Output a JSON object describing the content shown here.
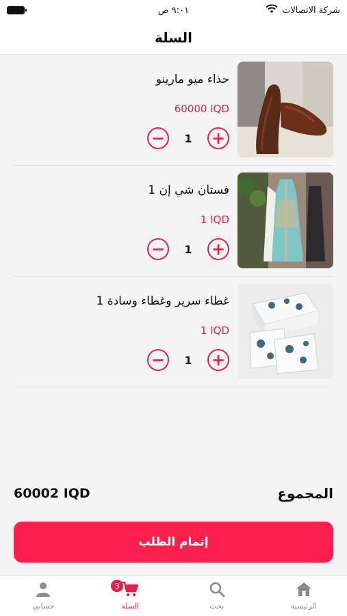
{
  "status_bar": {
    "carrier": "شركة الاتصالات",
    "time": "٩:٠١ ص"
  },
  "header": {
    "title": "السلة"
  },
  "cart": {
    "items": [
      {
        "name": "حذاء ميو مارينو",
        "price": "60000 IQD",
        "quantity": "1",
        "image": "brown-shoes"
      },
      {
        "name": "فستان شي إن 1",
        "price": "1 IQD",
        "quantity": "1",
        "image": "dress"
      },
      {
        "name": "غطاء سرير وغطاء وسادة 1",
        "price": "1 IQD",
        "quantity": "1",
        "image": "bedding"
      }
    ]
  },
  "summary": {
    "total_label": "المجموع",
    "total_amount": "60002 IQD",
    "checkout_label": "إتمام الطلب"
  },
  "bottom_nav": {
    "items": [
      {
        "label": "الرئيسية",
        "icon": "home-icon",
        "active": false
      },
      {
        "label": "بحث",
        "icon": "search-icon",
        "active": false
      },
      {
        "label": "السلة",
        "icon": "cart-icon",
        "active": true,
        "badge": "3"
      },
      {
        "label": "حسابي",
        "icon": "user-icon",
        "active": false
      }
    ]
  },
  "colors": {
    "accent": "#e5204a",
    "checkout": "#ff1f4f"
  }
}
